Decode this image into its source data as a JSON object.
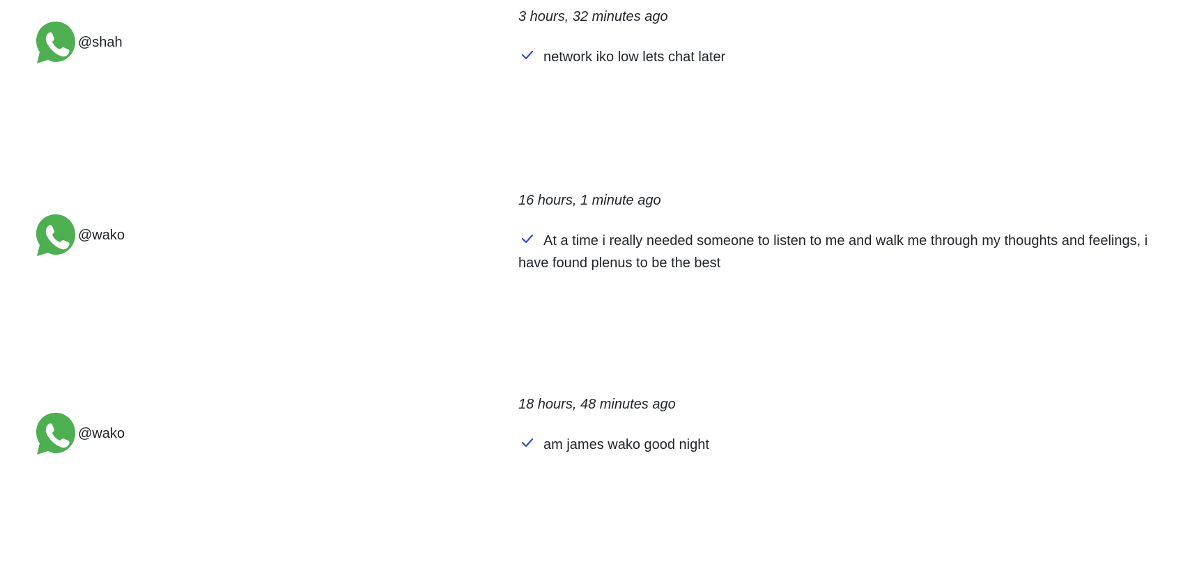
{
  "colors": {
    "avatar_green": "#4CAF50",
    "check_blue": "#2f48d8",
    "text": "#212529"
  },
  "posts": [
    {
      "handle": "@shah",
      "timestamp": "3 hours, 32 minutes ago",
      "message": "network iko low lets chat later",
      "status_icon": "check-icon",
      "avatar_icon": "whatsapp-icon"
    },
    {
      "handle": "@wako",
      "timestamp": "16 hours, 1 minute ago",
      "message": "At a time i really needed someone to listen to me and walk me through my thoughts and feelings, i have found plenus to be the best",
      "status_icon": "check-icon",
      "avatar_icon": "whatsapp-icon"
    },
    {
      "handle": "@wako",
      "timestamp": "18 hours, 48 minutes ago",
      "message": "am james wako good night",
      "status_icon": "check-icon",
      "avatar_icon": "whatsapp-icon"
    }
  ]
}
